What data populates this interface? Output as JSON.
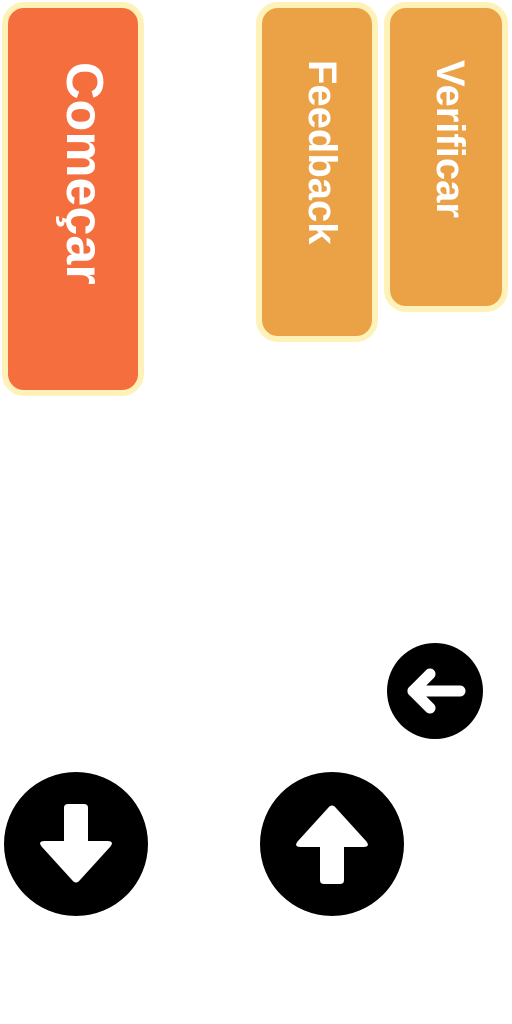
{
  "buttons": {
    "start_label": "Começar",
    "feedback_label": "Feedback",
    "verify_label": "Verificar"
  },
  "icons": {
    "back": "arrow-left-circle-icon",
    "down": "arrow-down-circle-icon",
    "up": "arrow-up-circle-icon"
  },
  "colors": {
    "start_button": "#f56e3d",
    "secondary_button": "#eba247",
    "button_border": "#fff2b8",
    "icon_fill": "#000000",
    "label_text": "#ffffff"
  }
}
